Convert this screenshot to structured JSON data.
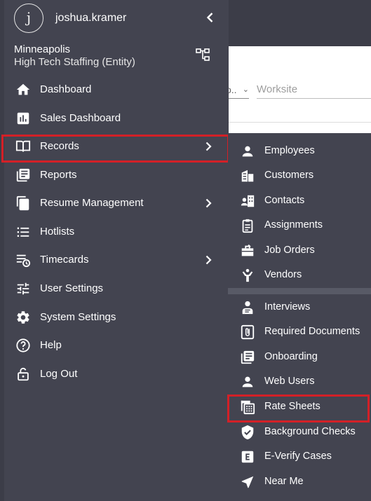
{
  "background": {
    "select_value": "o..",
    "worksite_placeholder": "Worksite"
  },
  "user": {
    "avatar_letter": "j",
    "username": "joshua.kramer"
  },
  "entity": {
    "city": "Minneapolis",
    "name": "High Tech Staffing (Entity)"
  },
  "nav": {
    "items": [
      {
        "label": "Dashboard",
        "icon": "home-icon"
      },
      {
        "label": "Sales Dashboard",
        "icon": "bar-chart-icon"
      },
      {
        "label": "Records",
        "icon": "book-icon",
        "has_submenu": true,
        "highlighted": true
      },
      {
        "label": "Reports",
        "icon": "reports-icon"
      },
      {
        "label": "Resume Management",
        "icon": "documents-icon",
        "has_submenu": true
      },
      {
        "label": "Hotlists",
        "icon": "list-icon"
      },
      {
        "label": "Timecards",
        "icon": "timecard-icon",
        "has_submenu": true
      },
      {
        "label": "User Settings",
        "icon": "sliders-icon"
      },
      {
        "label": "System Settings",
        "icon": "gear-icon"
      },
      {
        "label": "Help",
        "icon": "help-icon"
      },
      {
        "label": "Log Out",
        "icon": "lock-icon"
      }
    ]
  },
  "submenu": {
    "group1": [
      {
        "label": "Employees",
        "icon": "person-icon"
      },
      {
        "label": "Customers",
        "icon": "building-icon"
      },
      {
        "label": "Contacts",
        "icon": "contacts-icon"
      },
      {
        "label": "Assignments",
        "icon": "clipboard-icon"
      },
      {
        "label": "Job Orders",
        "icon": "job-orders-icon"
      },
      {
        "label": "Vendors",
        "icon": "vendor-icon"
      }
    ],
    "group2": [
      {
        "label": "Interviews",
        "icon": "interview-icon"
      },
      {
        "label": "Required Documents",
        "icon": "paperclip-icon"
      },
      {
        "label": "Onboarding",
        "icon": "onboarding-icon"
      },
      {
        "label": "Web Users",
        "icon": "person-icon"
      },
      {
        "label": "Rate Sheets",
        "icon": "calculator-icon",
        "highlighted": true
      },
      {
        "label": "Background Checks",
        "icon": "shield-check-icon"
      },
      {
        "label": "E-Verify Cases",
        "icon": "e-verify-icon"
      },
      {
        "label": "Near Me",
        "icon": "navigation-arrow-icon"
      }
    ]
  },
  "colors": {
    "sidebar_bg": "#434450",
    "highlight_border": "#d32027",
    "text": "#ffffff"
  }
}
